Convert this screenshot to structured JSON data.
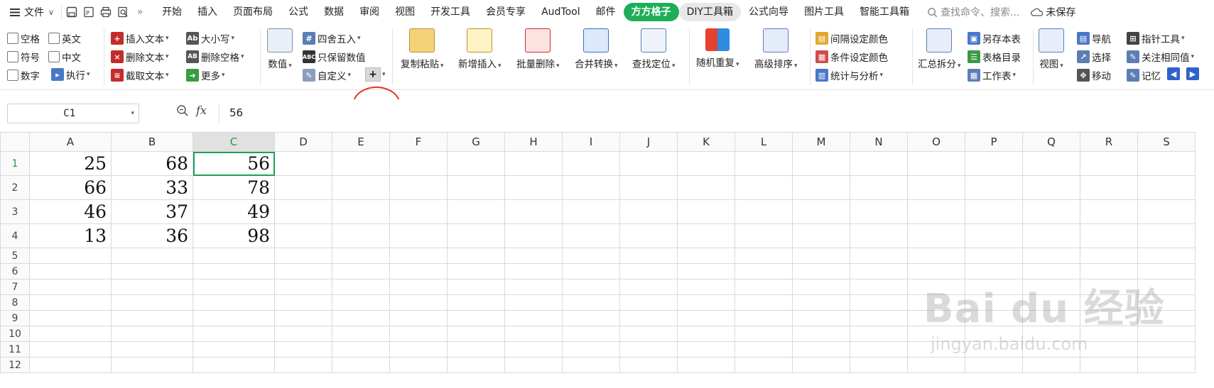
{
  "menubar": {
    "file_label": "文件",
    "tabs": [
      "开始",
      "插入",
      "页面布局",
      "公式",
      "数据",
      "审阅",
      "视图",
      "开发工具",
      "会员专享",
      "AudTool",
      "邮件",
      "方方格子",
      "DIY工具箱",
      "公式向导",
      "图片工具",
      "智能工具箱"
    ],
    "active_tab": "方方格子",
    "search_placeholder": "查找命令、搜索...",
    "unsaved_label": "未保存"
  },
  "ribbon": {
    "checks": [
      "空格",
      "英文",
      "符号",
      "中文",
      "数字"
    ],
    "exec_label": "执行",
    "text_tools": [
      "插入文本",
      "删除文本",
      "截取文本"
    ],
    "case_tools": [
      "大小写",
      "删除空格",
      "更多"
    ],
    "value_label": "数值",
    "round_label": "四舍五入",
    "keep_value_label": "只保留数值",
    "custom_label": "自定义",
    "big_buttons": [
      "复制粘贴",
      "新增插入",
      "批量删除",
      "合并转换",
      "查找定位",
      "随机重复",
      "高级排序"
    ],
    "color_tools": [
      "间隔设定颜色",
      "条件设定颜色",
      "统计与分析"
    ],
    "summary_label": "汇总拆分",
    "sheet_tools": [
      "另存本表",
      "表格目录",
      "工作表"
    ],
    "view_label": "视图",
    "nav_tools": [
      "导航",
      "选择",
      "移动"
    ],
    "pointer_tools": [
      "指针工具",
      "关注相同值",
      "记忆"
    ]
  },
  "formula_bar": {
    "cell_ref": "C1",
    "fx_label": "fx",
    "value": "56"
  },
  "sheet": {
    "columns": [
      "A",
      "B",
      "C",
      "D",
      "E",
      "F",
      "G",
      "H",
      "I",
      "J",
      "K",
      "L",
      "M",
      "N",
      "O",
      "P",
      "Q",
      "R",
      "S"
    ],
    "row_numbers": [
      "1",
      "2",
      "3",
      "4",
      "5",
      "6",
      "7",
      "8",
      "9",
      "10",
      "11",
      "12"
    ],
    "cells": [
      [
        "25",
        "68",
        "56"
      ],
      [
        "66",
        "33",
        "78"
      ],
      [
        "46",
        "37",
        "49"
      ],
      [
        "13",
        "36",
        "98"
      ]
    ],
    "selected_col": "C",
    "selected_row": "1"
  },
  "watermark": {
    "brand": "Bai du 经验",
    "url": "jingyan.baidu.com"
  },
  "colors": {
    "accent": "#1eae58",
    "grid": "#d4d9e6",
    "annotation": "#e8321e"
  }
}
